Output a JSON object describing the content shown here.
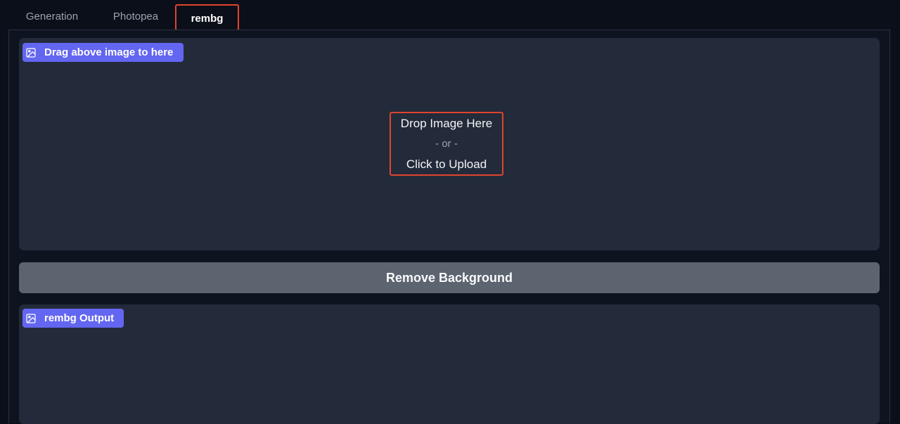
{
  "tabs": [
    {
      "label": "Generation",
      "active": false
    },
    {
      "label": "Photopea",
      "active": false
    },
    {
      "label": "rembg",
      "active": true
    }
  ],
  "input_image": {
    "label": "Drag above image to here",
    "icon": "image-icon",
    "drop_text": "Drop Image Here",
    "or_text": "- or -",
    "upload_text": "Click to Upload"
  },
  "remove_button": {
    "label": "Remove Background"
  },
  "output_image": {
    "label": "rembg Output",
    "icon": "image-icon"
  },
  "colors": {
    "background": "#0b0f19",
    "panel": "#232b3a",
    "accent": "#6366f1",
    "highlight": "#e0442e",
    "button": "#5c6470"
  }
}
